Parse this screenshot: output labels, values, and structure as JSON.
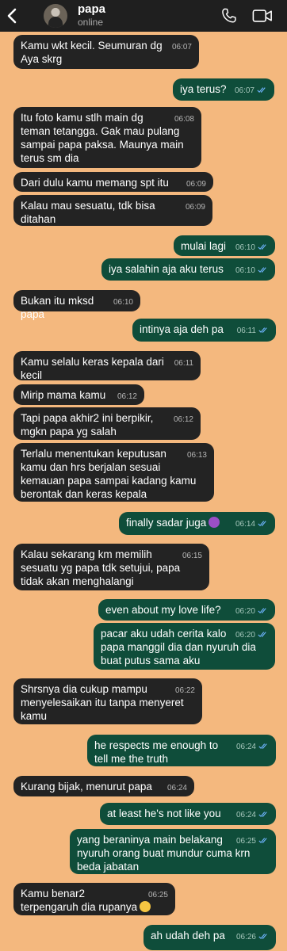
{
  "header": {
    "name": "papa",
    "status": "online"
  },
  "messages": [
    {
      "from": "in",
      "text": "Kamu wkt kecil. Seumuran dg Aya skrg",
      "time": "06:07"
    },
    {
      "from": "out",
      "text": "iya terus?",
      "time": "06:07"
    },
    {
      "from": "in",
      "text": "Itu foto kamu stlh main dg teman tetangga. Gak mau pulang sampai papa paksa. Maunya main terus sm dia",
      "time": "06:08"
    },
    {
      "from": "in",
      "text": "Dari dulu kamu memang spt itu",
      "time": "06:09"
    },
    {
      "from": "in",
      "text": "Kalau mau sesuatu, tdk bisa ditahan",
      "time": "06:09"
    },
    {
      "from": "out",
      "text": "mulai lagi",
      "time": "06:10"
    },
    {
      "from": "out",
      "text": "iya salahin aja aku terus",
      "time": "06:10"
    },
    {
      "from": "in",
      "text": "Bukan itu mksd papa",
      "time": "06:10"
    },
    {
      "from": "out",
      "text": "intinya aja deh pa",
      "time": "06:11"
    },
    {
      "from": "in",
      "text": "Kamu selalu keras kepala dari kecil",
      "time": "06:11"
    },
    {
      "from": "in",
      "text": "Mirip mama kamu",
      "time": "06:12"
    },
    {
      "from": "in",
      "text": "Tapi papa akhir2 ini berpikir, mgkn papa yg salah",
      "time": "06:12"
    },
    {
      "from": "in",
      "text": "Terlalu menentukan keputusan kamu dan hrs berjalan sesuai kemauan papa sampai kadang kamu berontak dan keras kepala",
      "time": "06:13"
    },
    {
      "from": "out",
      "text": "finally sadar juga",
      "time": "06:14",
      "emoji": "woman-gesturing-icon"
    },
    {
      "from": "in",
      "text": "Kalau sekarang km memilih sesuatu yg papa tdk setujui, papa tidak akan menghalangi",
      "time": "06:15"
    },
    {
      "from": "out",
      "text": "even about my love life?",
      "time": "06:20"
    },
    {
      "from": "out",
      "text": "pacar aku udah cerita kalo papa manggil dia dan nyuruh dia buat putus sama aku",
      "time": "06:20"
    },
    {
      "from": "in",
      "text": "Shrsnya dia cukup mampu menyelesaikan itu tanpa menyeret kamu",
      "time": "06:22"
    },
    {
      "from": "out",
      "text": "he respects me enough to tell me the truth",
      "time": "06:24"
    },
    {
      "from": "in",
      "text": "Kurang bijak, menurut papa",
      "time": "06:24"
    },
    {
      "from": "out",
      "text": "at least he's not like you",
      "time": "06:24"
    },
    {
      "from": "out",
      "text": "yang beraninya main belakang nyuruh orang buat mundur cuma krn beda jabatan",
      "time": "06:25"
    },
    {
      "from": "in",
      "text": "Kamu benar2 terpengaruh dia rupanya",
      "time": "06:25",
      "emoji": "laughing-tears-icon"
    },
    {
      "from": "out",
      "text": "ah udah deh pa",
      "time": "06:26"
    }
  ]
}
